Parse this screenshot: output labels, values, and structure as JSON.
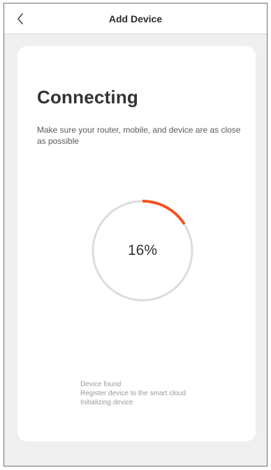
{
  "header": {
    "title": "Add Device",
    "back_icon": "chevron-left-icon"
  },
  "main": {
    "heading": "Connecting",
    "description": "Make sure your router, mobile, and device are as close as possible",
    "progress": {
      "value": 16,
      "label": "16%",
      "track_color": "#dcdcdc",
      "fill_color": "#f0531f"
    },
    "steps": [
      "Device found",
      "Register device to the smart cloud",
      "Initializing device"
    ]
  }
}
